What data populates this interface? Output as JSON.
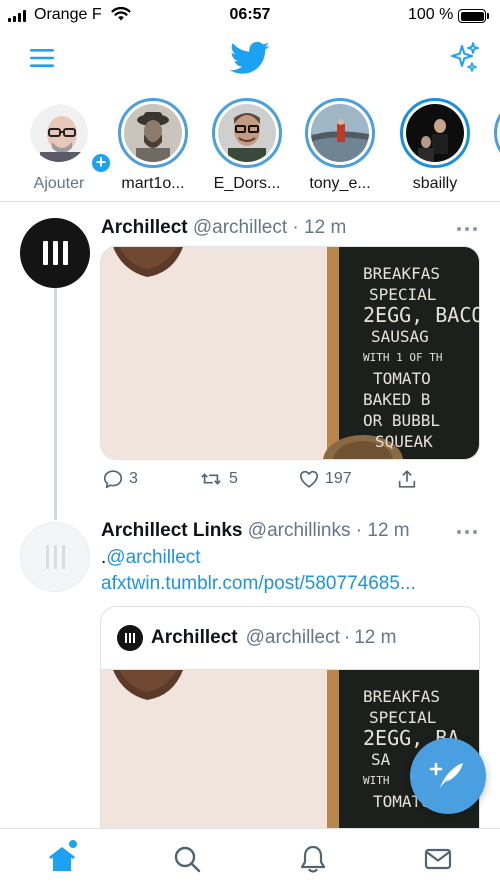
{
  "status_bar": {
    "carrier": "Orange F",
    "time": "06:57",
    "battery": "100 %"
  },
  "header": {
    "menu_icon": "hamburger-menu-icon",
    "logo_icon": "twitter-bird-icon",
    "sparkle_icon": "sparkle-icon"
  },
  "fleets": [
    {
      "name": "Ajouter",
      "icon": "add-plus-icon"
    },
    {
      "name": "mart1o..."
    },
    {
      "name": "E_Dors..."
    },
    {
      "name": "tony_e..."
    },
    {
      "name": "sbailly"
    }
  ],
  "timeline": [
    {
      "author": "Archillect",
      "handle": "@archillect",
      "separator": "·",
      "time": "12 m",
      "media": {
        "board_lines": [
          "BREAKFAS",
          "SPECIAL",
          "2EGG, BACO",
          "SAUSAG",
          "WITH 1 OF TH",
          "TOMATO",
          "BAKED B",
          "OR BUBBL",
          "SQUEAK"
        ]
      },
      "actions": {
        "replies": "3",
        "retweets": "5",
        "likes": "197"
      }
    },
    {
      "author": "Archillect Links",
      "handle": "@archillinks",
      "separator": "·",
      "time": "12 m",
      "text_prefix": ".",
      "mention": "@archillect",
      "link": "afxtwin.tumblr.com/post/580774685...",
      "quote": {
        "author": "Archillect",
        "handle": "@archillect",
        "separator": "·",
        "time": "12 m",
        "board_lines": [
          "BREAKFAS",
          "SPECIAL",
          "2EGG, BA",
          "SA",
          "WITH",
          "TOMATO"
        ]
      }
    }
  ],
  "fab": {
    "icon": "compose-tweet-icon"
  },
  "tabs": [
    {
      "name": "home",
      "icon": "home-icon"
    },
    {
      "name": "search",
      "icon": "search-icon"
    },
    {
      "name": "notifications",
      "icon": "bell-icon"
    },
    {
      "name": "messages",
      "icon": "mail-icon"
    }
  ],
  "colors": {
    "accent": "#1da1f2",
    "link": "#1b95e0",
    "muted": "#657786",
    "fab": "#4a9fe1"
  }
}
